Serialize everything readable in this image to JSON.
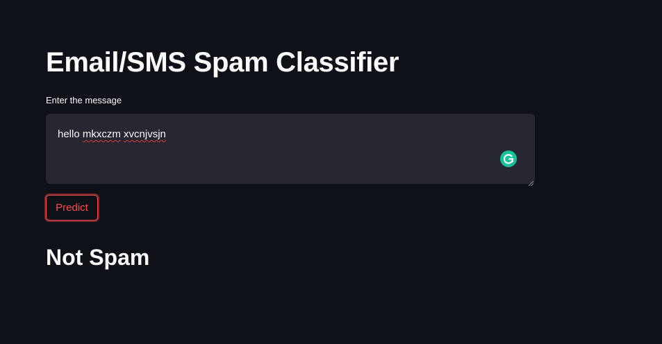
{
  "page": {
    "title": "Email/SMS Spam Classifier",
    "input_label": "Enter the message",
    "message": {
      "words": [
        "hello",
        "mkxczm",
        "xvcnjvsjn"
      ],
      "misspelled": [
        "mkxczm",
        "xvcnjvsjn"
      ]
    },
    "predict_label": "Predict",
    "result": "Not Spam"
  },
  "icons": {
    "grammarly": "grammarly-icon",
    "resize": "resize-handle-icon"
  },
  "colors": {
    "background": "#0e1117",
    "input_background": "#262730",
    "text": "#fafafa",
    "accent": "#ff4b4b",
    "grammarly": "#15c39a"
  }
}
